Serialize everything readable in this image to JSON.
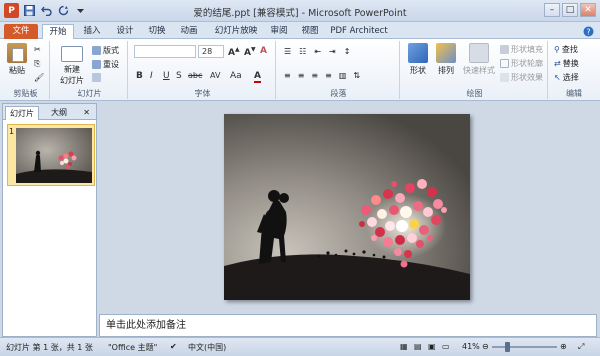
{
  "window": {
    "title": "爱的结尾.ppt [兼容模式] - Microsoft PowerPoint",
    "app_icon": "P",
    "qat": {
      "save_icon": "save-icon",
      "undo_icon": "undo-icon",
      "redo_icon": "redo-icon"
    },
    "controls": {
      "minimize": "–",
      "maximize": "□",
      "close": "✕"
    }
  },
  "tabs": [
    {
      "label": "文件"
    },
    {
      "label": "开始"
    },
    {
      "label": "插入"
    },
    {
      "label": "设计"
    },
    {
      "label": "切换"
    },
    {
      "label": "动画"
    },
    {
      "label": "幻灯片放映"
    },
    {
      "label": "审阅"
    },
    {
      "label": "视图"
    },
    {
      "label": "PDF Architect"
    }
  ],
  "active_tab": "开始",
  "ribbon": {
    "clipboard": {
      "paste": "粘贴",
      "group": "剪贴板"
    },
    "slides": {
      "new_slide": "新建",
      "new_slide2": "幻灯片",
      "layout": "版式",
      "reset": "重设",
      "group": "幻灯片"
    },
    "font": {
      "font_name": "",
      "font_size": "28",
      "group": "字体",
      "bold": "B",
      "italic": "I",
      "underline": "U",
      "strike": "S",
      "shadow": "abc",
      "spacing": "AV",
      "case": "Aa",
      "color": "A"
    },
    "paragraph": {
      "group": "段落"
    },
    "drawing": {
      "shapes": "形状",
      "arrange": "排列",
      "quick_styles": "快速样式",
      "shape_fill": "形状填充",
      "shape_outline": "形状轮廓",
      "shape_effects": "形状效果",
      "group": "绘图"
    },
    "editing": {
      "find": "查找",
      "replace": "替换",
      "select": "选择",
      "group": "编辑"
    }
  },
  "left_panel": {
    "tab_slides": "幻灯片",
    "tab_outline": "大纲",
    "close": "✕",
    "slide_number": "1"
  },
  "notes_placeholder": "单击此处添加备注",
  "status": {
    "slide_info": "幻灯片 第 1 张，共 1 张",
    "theme": "\"Office 主题\"",
    "language": "中文(中国)",
    "zoom": "41%",
    "zoom_fraction": 0.41
  },
  "colors": {
    "file_tab": "#d55a2a",
    "accent": "#2a5599",
    "thumb_highlight": "#fbe7a2"
  }
}
